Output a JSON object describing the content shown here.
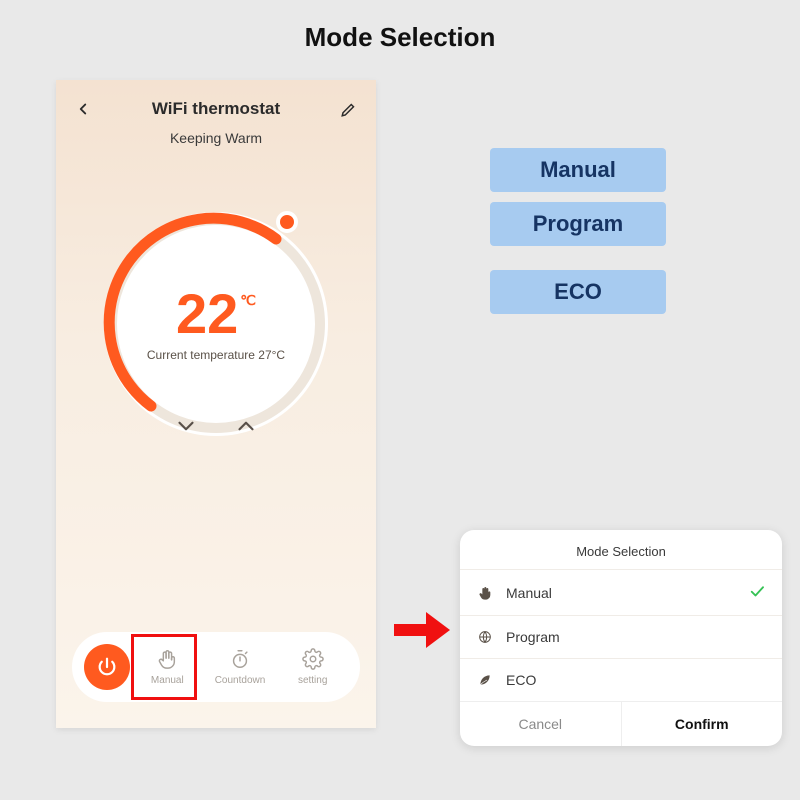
{
  "page_title": "Mode Selection",
  "phone": {
    "title": "WiFi thermostat",
    "status": "Keeping Warm",
    "set_temp": "22",
    "unit": "℃",
    "current": "Current temperature 27°C",
    "bar": {
      "manual": "Manual",
      "countdown": "Countdown",
      "setting": "setting"
    }
  },
  "pills": {
    "p1": "Manual",
    "p2": "Program",
    "p3": "ECO"
  },
  "popup": {
    "title": "Mode Selection",
    "opt_manual": "Manual",
    "opt_program": "Program",
    "opt_eco": "ECO",
    "cancel": "Cancel",
    "confirm": "Confirm"
  }
}
